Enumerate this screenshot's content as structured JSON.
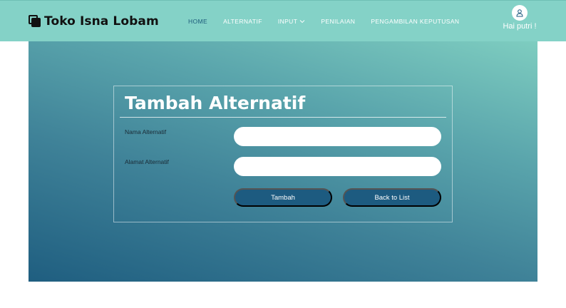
{
  "brand": {
    "name": "Toko Isna Lobam",
    "icon": "copy-squares-icon"
  },
  "nav": {
    "items": [
      {
        "label": "HOME",
        "active": true
      },
      {
        "label": "ALTERNATIF",
        "active": false
      },
      {
        "label": "INPUT",
        "active": false,
        "icon": "chevron-down-icon"
      },
      {
        "label": "PENILAIAN",
        "active": false
      },
      {
        "label": "PENGAMBILAN KEPUTUSAN",
        "active": false
      }
    ]
  },
  "user": {
    "greeting": "Hai putri !",
    "icon": "user-icon"
  },
  "form": {
    "title": "Tambah Alternatif",
    "fields": [
      {
        "label": "Nama Alternatif",
        "value": "",
        "placeholder": ""
      },
      {
        "label": "Alamat Alternatif",
        "value": "",
        "placeholder": ""
      }
    ],
    "submit_label": "Tambah",
    "back_label": "Back to List"
  },
  "colors": {
    "navbar": "#84d2c7",
    "accent": "#1d5b80",
    "active_nav": "#1c5a7a"
  }
}
